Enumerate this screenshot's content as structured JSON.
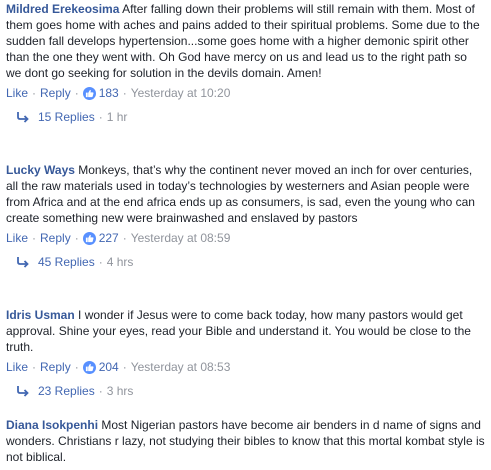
{
  "comments": [
    {
      "author": "Mildred Erekeosima",
      "text": "After falling down their problems will still remain with them. Most of them goes home with aches and pains added to their spiritual problems. Some due to the sudden fall develops hypertension...some goes home with a higher demonic spirit other than the one they went with. Oh God have mercy on us and lead us to the right path so we dont go seeking for solution in the devils domain. Amen!",
      "like_label": "Like",
      "reply_label": "Reply",
      "like_count": "183",
      "timestamp": "Yesterday at 10:20",
      "replies_label": "15 Replies",
      "replies_time": "1 hr"
    },
    {
      "author": "Lucky Ways",
      "text": "Monkeys, that’s why the continent never moved an inch for over centuries, all the raw materials used in today’s technologies by westerners and Asian people were from Africa and at the end africa ends up as consumers, is sad, even the young who can create something new were brainwashed and enslaved by pastors",
      "like_label": "Like",
      "reply_label": "Reply",
      "like_count": "227",
      "timestamp": "Yesterday at 08:59",
      "replies_label": "45 Replies",
      "replies_time": "4 hrs"
    },
    {
      "author": "Idris Usman",
      "text": "I wonder if Jesus were to come back today, how many pastors would get approval. Shine your eyes, read your Bible and understand it. You would be close to the truth.",
      "like_label": "Like",
      "reply_label": "Reply",
      "like_count": "204",
      "timestamp": "Yesterday at 08:53",
      "replies_label": "23 Replies",
      "replies_time": "3 hrs"
    },
    {
      "author": "Diana Isokpenhi",
      "text": "Most Nigerian pastors have become air benders in d name of signs and wonders. Christians r lazy, not studying their bibles to know that this mortal kombat style is not biblical."
    }
  ],
  "separator": "·",
  "icons": {
    "like_badge": "thumbs-up-icon",
    "reply_arrow": "reply-arrow-icon"
  },
  "colors": {
    "author": "#365899",
    "link": "#4267b2",
    "meta": "#90949c",
    "like_badge": "#5890ff"
  }
}
